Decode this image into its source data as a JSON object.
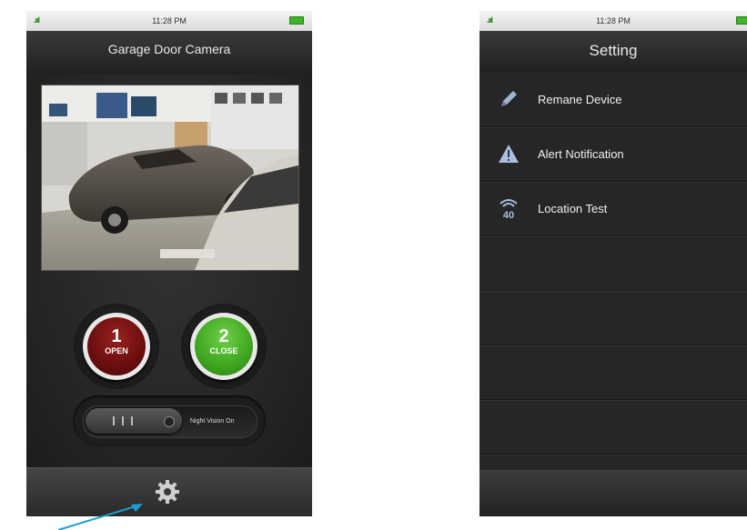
{
  "left_screen": {
    "status": {
      "signal": ".ııl",
      "time": "11:28 PM"
    },
    "title": "Garage Door Camera",
    "buttons": {
      "open": {
        "number": "1",
        "label": "OPEN"
      },
      "close": {
        "number": "2",
        "label": "CLOSE"
      }
    },
    "night_vision": {
      "label": "Night Vision On"
    },
    "colors": {
      "open": "#7a1212",
      "close": "#3ea51e"
    }
  },
  "right_screen": {
    "status": {
      "signal": ".ııl",
      "time": "11:28 PM"
    },
    "title": "Setting",
    "items": [
      {
        "label": "Remane Device",
        "icon": "pencil-icon"
      },
      {
        "label": "Alert Notification",
        "icon": "warning-icon"
      },
      {
        "label": "Location Test",
        "icon": "wifi-40-icon"
      }
    ]
  }
}
